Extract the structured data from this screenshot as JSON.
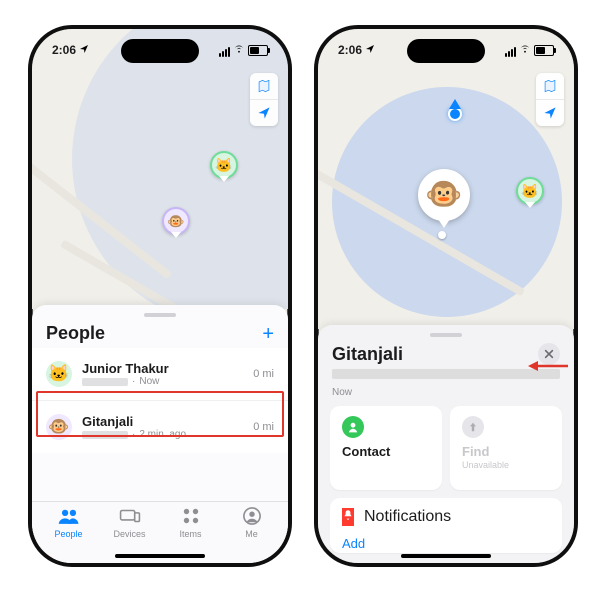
{
  "status": {
    "time": "2:06",
    "location_glyph": "loc-arrow-icon",
    "battery_pct": 55
  },
  "map_controls": {
    "mode": "map-mode-icon",
    "locate": "locate-icon"
  },
  "people_sheet": {
    "title": "People",
    "add_label": "+",
    "rows": [
      {
        "name": "Junior Thakur",
        "time": "Now",
        "distance": "0 mi",
        "avatar": "🐱"
      },
      {
        "name": "Gitanjali",
        "time": "2 min. ago",
        "distance": "0 mi",
        "avatar": "🐵"
      }
    ]
  },
  "tabs": {
    "people": "People",
    "devices": "Devices",
    "items": "Items",
    "me": "Me"
  },
  "detail_sheet": {
    "title": "Gitanjali",
    "sub_time": "Now",
    "contact_label": "Contact",
    "find_label": "Find",
    "find_sub": "Unavailable",
    "notifications_label": "Notifications",
    "add_label": "Add"
  },
  "icons": {
    "contact": "person-circle-icon",
    "find": "arrow-up-circle-icon",
    "bell": "bell-circle-icon"
  }
}
